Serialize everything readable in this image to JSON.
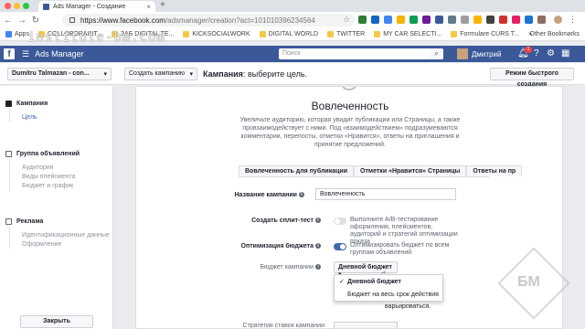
{
  "browser": {
    "tab_title": "Ads Manager - Создание",
    "url_domain": "https://www.facebook.com",
    "url_path": "/adsmanager/creation?act=101010396234564",
    "watermark": "institute-bm.com",
    "bookmarks": [
      "Apps",
      "COLLOBORAINT...",
      "ЗАБ DIGITAL TE...",
      "KICKSOCIALWORK",
      "DIGITAL WORLD",
      "TWITTER",
      "MY CAR SELECTI...",
      "Formulare CURS T...",
      "»"
    ],
    "other_bookmarks": "Other Bookmarks"
  },
  "fb_bar": {
    "logo": "f",
    "app_name": "Ads Manager",
    "search_placeholder": "Поиск",
    "user_name": "Дмитрий",
    "notif_count": "1"
  },
  "toolbar": {
    "account": "Dumitru Talmazan - con...",
    "create_campaign": "Создать кампанию",
    "campaign_bold": "Кампания",
    "campaign_rest": ": выберите цель.",
    "quick_create": "Режим быстрого создания"
  },
  "sidebar": {
    "campaign": {
      "label": "Кампания",
      "items": [
        "Цель"
      ]
    },
    "adset": {
      "label": "Группа объявлений",
      "items": [
        "Аудитория",
        "Виды плейсмента",
        "Бюджет и график"
      ]
    },
    "ad": {
      "label": "Реклама",
      "items": [
        "Идентификационные данные",
        "Оформление"
      ]
    },
    "close": "Закрыть"
  },
  "main": {
    "title": "Вовлеченность",
    "description": "Увеличьте аудиторию, которая увидит публикации или Страницы, а также провзаимодействует с ними. Под «взаимодействием» подразумеваются комментарии, перепосты, отметки «Нравится», ответы на приглашения и принятие предложений.",
    "tabs": [
      "Вовлеченность для публикации",
      "Отметки «Нравится» Страницы",
      "Ответы на пр"
    ],
    "campaign_name_label": "Название кампании",
    "campaign_name_value": "Вовлеченность",
    "split_label": "Создать сплит-тест",
    "split_text": "Выполните A/B-тестирование оформления, плейсментов, аудиторий и стратегий оптимизации показа",
    "budget_opt_label": "Оптимизация бюджета",
    "budget_opt_text": "Оптимизировать бюджет по всем группам объявлений",
    "budget_label": "Бюджет кампании",
    "budget_value": "Дневной бюджет",
    "dropdown_options": [
      "Дневной бюджет",
      "Бюджет на весь срок действия"
    ],
    "varies": "варьироваться.",
    "bid_label": "Стратегия ставок кампании"
  },
  "colors": {
    "fb_blue": "#3b5998",
    "accent": "#4267b2"
  },
  "logo_watermark": "БМ"
}
